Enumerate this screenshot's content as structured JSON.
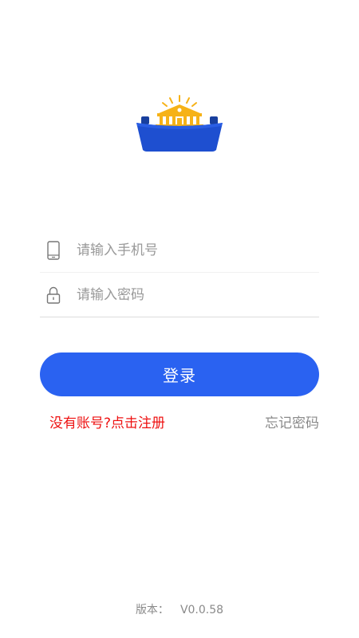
{
  "login": {
    "phone_placeholder": "请输入手机号",
    "password_placeholder": "请输入密码",
    "phone_icon": "phone-icon",
    "lock_icon": "lock-icon",
    "login_label": "登录",
    "register_label": "没有账号?点击注册",
    "forgot_label": "忘记密码"
  },
  "footer": {
    "version_label": "版本：",
    "version_value": "V0.0.58"
  },
  "colors": {
    "primary": "#2a62f1",
    "register_text": "#ee1111",
    "muted_text": "#8a8a8a",
    "logo_blue": "#1e4fd0",
    "logo_gold": "#f6b217"
  }
}
